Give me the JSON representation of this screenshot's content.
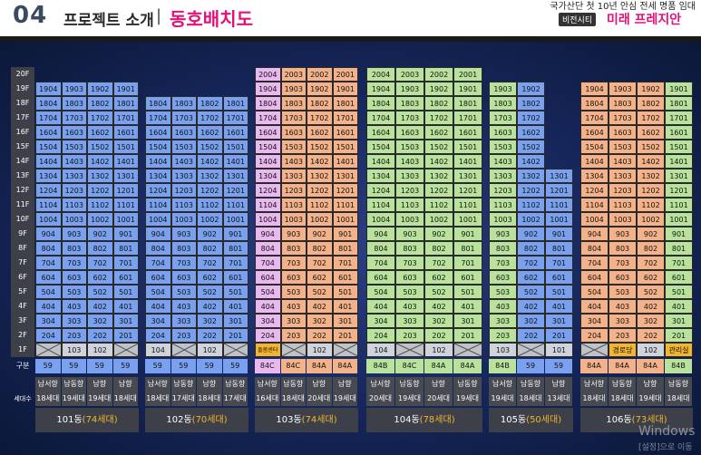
{
  "header": {
    "num": "04",
    "title": "프로젝트 소개",
    "sep": "|",
    "sub": "동호배치도",
    "tag": "국가산단 첫 10년 안심 전세 명품 임대",
    "badge": "비전시티",
    "brand": "미래 프레지안"
  },
  "floor_labels": [
    "20F",
    "19F",
    "18F",
    "17F",
    "16F",
    "15F",
    "14F",
    "13F",
    "12F",
    "11F",
    "10F",
    "9F",
    "8F",
    "7F",
    "6F",
    "5F",
    "4F",
    "3F",
    "2F",
    "1F"
  ],
  "row_labels": {
    "type": "구분",
    "count": "세대수"
  },
  "watermark": {
    "line1": "Windows",
    "line2": "[설정]으로 이동"
  },
  "buildings": [
    {
      "name": "101동",
      "count": "(74세대)",
      "units": [
        "1904",
        "1903",
        "1902",
        "1901"
      ],
      "floors": [
        1,
        2,
        3,
        4,
        5,
        6,
        7,
        8,
        9,
        10,
        11,
        12,
        13,
        14,
        15,
        16,
        17,
        18,
        19
      ],
      "floor1": [
        "X",
        "103",
        "102",
        "X"
      ],
      "types": [
        "59",
        "59",
        "59",
        "59"
      ],
      "dirs": [
        "남서향",
        "남동향",
        "남향",
        "남향"
      ],
      "counts": [
        "18세대",
        "19세대",
        "19세대",
        "18세대"
      ],
      "colors": [
        "#7aa1f0",
        "#7aa1f0",
        "#7aa1f0",
        "#7aa1f0"
      ]
    },
    {
      "name": "102동",
      "count": "(70세대)",
      "units": [
        "1804",
        "1803",
        "1802",
        "1801"
      ],
      "floors": [
        1,
        2,
        3,
        4,
        5,
        6,
        7,
        8,
        9,
        10,
        11,
        12,
        13,
        14,
        15,
        16,
        17,
        18
      ],
      "floor1": [
        "104",
        "X",
        "102",
        "X"
      ],
      "types": [
        "59",
        "59",
        "59",
        "59"
      ],
      "dirs": [
        "남서향",
        "남동향",
        "남향",
        "남동향"
      ],
      "counts": [
        "18세대",
        "17세대",
        "18세대",
        "17세대"
      ],
      "colors": [
        "#7aa1f0",
        "#7aa1f0",
        "#7aa1f0",
        "#7aa1f0"
      ]
    },
    {
      "name": "103동",
      "count": "(74세대)",
      "units": [
        "2004",
        "2003",
        "2002",
        "2001"
      ],
      "floors": [
        1,
        2,
        3,
        4,
        5,
        6,
        7,
        8,
        9,
        10,
        11,
        12,
        13,
        14,
        15,
        16,
        17,
        18,
        19,
        20
      ],
      "floor1": [
        "돌봄센터",
        "X",
        "102",
        "X"
      ],
      "types": [
        "84C",
        "84C",
        "84A",
        "84A"
      ],
      "dirs": [
        "남서향",
        "남동향",
        "남향",
        "남향"
      ],
      "counts": [
        "16세대",
        "18세대",
        "20세대",
        "19세대"
      ],
      "colors": [
        "#e9b8ee",
        "#f3b28a",
        "#f3b28a",
        "#f3b28a"
      ]
    },
    {
      "name": "104동",
      "count": "(78세대)",
      "units": [
        "2004",
        "2003",
        "2002",
        "2001"
      ],
      "floors": [
        1,
        2,
        3,
        4,
        5,
        6,
        7,
        8,
        9,
        10,
        11,
        12,
        13,
        14,
        15,
        16,
        17,
        18,
        19,
        20
      ],
      "floor1": [
        "104",
        "X",
        "102",
        "X"
      ],
      "types": [
        "84B",
        "84C",
        "84A",
        "84A"
      ],
      "dirs": [
        "남서향",
        "남동향",
        "남향",
        "남동향"
      ],
      "counts": [
        "20세대",
        "19세대",
        "20세대",
        "19세대"
      ],
      "colors": [
        "#b9e39d",
        "#b9e39d",
        "#b9e39d",
        "#b9e39d"
      ]
    },
    {
      "name": "105동",
      "count": "(50세대)",
      "units": [
        "1903",
        "1902",
        "1301"
      ],
      "floors": [
        1,
        2,
        3,
        4,
        5,
        6,
        7,
        8,
        9,
        10,
        11,
        12,
        13,
        14,
        15,
        16,
        17,
        18,
        19
      ],
      "floor1": [
        "103",
        "X",
        "101"
      ],
      "types": [
        "84B",
        "59",
        "59"
      ],
      "dirs": [
        "남서향",
        "남동향",
        "남향"
      ],
      "counts": [
        "19세대",
        "18세대",
        "13세대"
      ],
      "colors": [
        "#b9e39d",
        "#7aa1f0",
        "#7aa1f0"
      ]
    },
    {
      "name": "106동",
      "count": "(73세대)",
      "units": [
        "1904",
        "1903",
        "1902",
        "1901"
      ],
      "floors": [
        1,
        2,
        3,
        4,
        5,
        6,
        7,
        8,
        9,
        10,
        11,
        12,
        13,
        14,
        15,
        16,
        17,
        18,
        19
      ],
      "floor1": [
        "X",
        "경로당",
        "102",
        "관리실"
      ],
      "types": [
        "84A",
        "84A",
        "84A",
        "84B"
      ],
      "dirs": [
        "남서향",
        "남동향",
        "남향",
        "남동향"
      ],
      "counts": [
        "18세대",
        "18세대",
        "19세대",
        "18세대"
      ],
      "colors": [
        "#f3b28a",
        "#f3b28a",
        "#f3b28a",
        "#b9e39d"
      ]
    }
  ]
}
